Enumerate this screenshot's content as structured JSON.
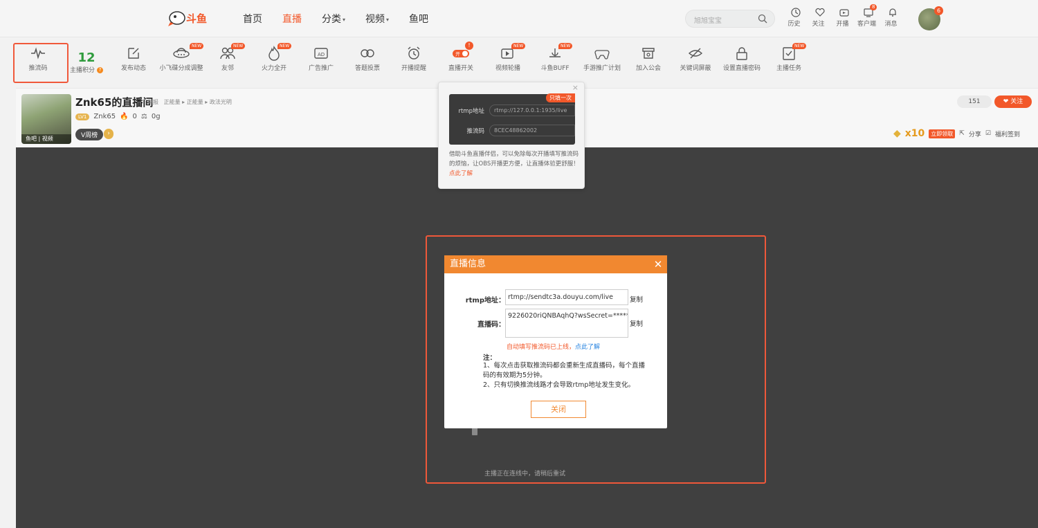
{
  "colors": {
    "accent": "#f2582a",
    "modal_header": "#f18830",
    "video_bg": "#404040",
    "score": "#2e9b3c"
  },
  "nav": {
    "logo_text": "斗鱼",
    "links": [
      "首页",
      "直播",
      "分类",
      "视频",
      "鱼吧"
    ],
    "active": "直播",
    "search_placeholder": "旭旭宝宝",
    "right_items": [
      "历史",
      "关注",
      "开播",
      "客户端",
      "消息"
    ],
    "client_badge": "8",
    "avatar_badge": "6"
  },
  "tools": {
    "push_code": "推流码",
    "score_value": "12",
    "score_label": "主播积分",
    "post": "发布动态",
    "plane": "小飞碟分成调整",
    "friends": "友邻",
    "fire": "火力全开",
    "ad": "广告推广",
    "vote": "答题投票",
    "remind": "开播提醒",
    "switch": "直播开关",
    "switch_on": "开",
    "switch_badge": "!",
    "video_carousel": "视频轮播",
    "buff": "斗鱼BUFF",
    "mobile_game": "手游推广计划",
    "guild": "加入公会",
    "shield": "关键词屏蔽",
    "password": "设置直播密码",
    "tasks": "主播任务",
    "new_badge": "NEW"
  },
  "room": {
    "title": "Znk65的直播间",
    "report": "举报",
    "breadcrumb": "正能量 ▸ 正能量 ▸ 政法光明",
    "level": "LV1",
    "anchor": "Znk65",
    "hot": "0",
    "gift": "0g",
    "thumb_tag": "鱼吧 | 视频",
    "vrank": "V周榜",
    "fans": "151",
    "follow": "❤ 关注",
    "gold_count": "x10",
    "claim": "立即领取",
    "share": "分享",
    "sign_in": "福利签到"
  },
  "popover": {
    "rtmp_label": "rtmp地址",
    "rtmp_value": "rtmp://127.0.0.1:1935/live",
    "code_label": "推流码",
    "code_value": "8CEC48862002",
    "once": "只填一次",
    "desc": "借助斗鱼直播伴侣，可以免除每次开播填写推流码的烦恼，让OBS开播更方便，让直播体验更舒服！",
    "learn_more": "点此了解"
  },
  "modal": {
    "title": "直播信息",
    "rtmp_label": "rtmp地址：",
    "rtmp_value": "rtmp://sendtc3a.douyu.com/live",
    "code_label": "直播码：",
    "code_value": "9226020riQNBAqhQ?wsSecret=********",
    "copy": "复制",
    "auto_fill": "自动填写推流码已上线，",
    "auto_link": "点此了解",
    "note_title": "注：",
    "note_1": "1、每次点击获取推流码都会重新生成直播码，每个直播码的有效期为5分钟。",
    "note_2": "2、只有切换推流线路才会导致rtmp地址发生变化。",
    "close": "关闭"
  },
  "video": {
    "offline_text": "主播正在连线中，请稍后重试"
  }
}
